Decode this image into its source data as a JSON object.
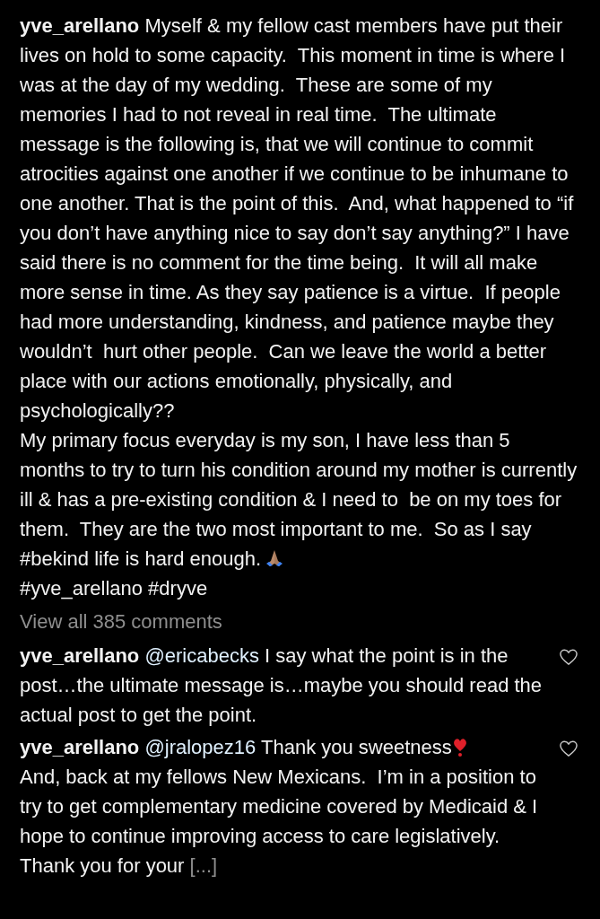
{
  "caption": {
    "username": "yve_arellano",
    "paragraphs": [
      "Myself & my fellow cast members have put their lives on hold to some capacity.  This moment in time is where I was at the day of my wedding.  These are some of my memories I had to not reveal in real time.  The ultimate message is the following is, that we will continue to commit atrocities against one another if we continue to be inhumane to one another. That is the point of this.  And, what happened to “if you don’t have anything nice to say don’t say anything?” I have said there is no comment for the time being.  It will all make more sense in time. As they say patience is a virtue.  If people had more understanding, kindness, and patience maybe they wouldn’t  hurt other people.  Can we leave the world a better place with our actions emotionally, physically, and psychologically??",
      "My primary focus everyday is my son, I have less than 5 months to try to turn his condition around my mother is currently ill & has a pre-existing condition & I need to  be on my toes for them.  They are the two most important to me.  So as I say #bekind life is hard enough."
    ],
    "hashtags": "#yve_arellano #dryve"
  },
  "view_all": "View all 385 comments",
  "comments": [
    {
      "username": "yve_arellano",
      "parts": [
        {
          "kind": "mention",
          "text": "@ericabecks"
        },
        {
          "kind": "text",
          "text": " I say what the point is in the post…the ultimate message is…maybe you should read the actual post to get the point."
        }
      ]
    },
    {
      "username": "yve_arellano",
      "parts": [
        {
          "kind": "mention",
          "text": "@jralopez16"
        },
        {
          "kind": "text",
          "text": " Thank you sweetness"
        },
        {
          "kind": "heart"
        },
        {
          "kind": "break"
        },
        {
          "kind": "text",
          "text": "And, back at my fellows New Mexicans.  I’m in a position to try to get complementary medicine covered by Medicaid & I hope to continue improving access to care legislatively.  Thank you for your "
        },
        {
          "kind": "more",
          "text": "[...]"
        }
      ]
    }
  ]
}
